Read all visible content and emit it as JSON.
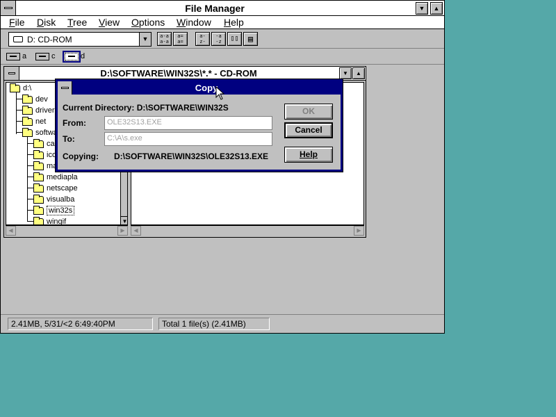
{
  "window": {
    "title": "File Manager"
  },
  "menu": [
    {
      "label": "File",
      "accel": "F"
    },
    {
      "label": "Disk",
      "accel": "D"
    },
    {
      "label": "Tree",
      "accel": "T"
    },
    {
      "label": "View",
      "accel": "V"
    },
    {
      "label": "Options",
      "accel": "O"
    },
    {
      "label": "Window",
      "accel": "W"
    },
    {
      "label": "Help",
      "accel": "H"
    }
  ],
  "toolbar": {
    "drive_selected": "D: CD-ROM",
    "buttons": [
      {
        "name": "view-large-icons-button",
        "glyph": "a-a\na-a"
      },
      {
        "name": "view-details-button",
        "glyph": "a=\na="
      },
      {
        "name": "sort-by-name-button",
        "glyph": "a-\nz-"
      },
      {
        "name": "sort-by-type-button",
        "glyph": "-a\n-z"
      },
      {
        "name": "copy-button",
        "glyph": "▯▯"
      },
      {
        "name": "properties-button",
        "glyph": "▤"
      }
    ]
  },
  "drives": [
    {
      "letter": "a",
      "active": false
    },
    {
      "letter": "c",
      "active": false
    },
    {
      "letter": "d",
      "active": true
    }
  ],
  "dir_window": {
    "title": "D:\\SOFTWARE\\WIN32S\\*.* - CD-ROM",
    "tree": [
      {
        "label": "d:\\",
        "level": 0
      },
      {
        "label": "dev",
        "level": 1
      },
      {
        "label": "drivers",
        "level": 1
      },
      {
        "label": "net",
        "level": 1
      },
      {
        "label": "softwa",
        "level": 1
      },
      {
        "label": "cal",
        "level": 2
      },
      {
        "label": "ico",
        "level": 2
      },
      {
        "label": "ma",
        "level": 2
      },
      {
        "label": "mediapla",
        "level": 2
      },
      {
        "label": "netscape",
        "level": 2
      },
      {
        "label": "visualba",
        "level": 2
      },
      {
        "label": "win32s",
        "level": 2,
        "selected": true
      },
      {
        "label": "wingif",
        "level": 2
      }
    ]
  },
  "copy_dialog": {
    "title": "Copy",
    "current_dir_label": "Current Directory:",
    "current_dir": "D:\\SOFTWARE\\WIN32S",
    "from_label": "From:",
    "from_value": "OLE32S13.EXE",
    "to_label": "To:",
    "to_value": "C:\\A\\s.exe",
    "copying_label": "Copying:",
    "copying_value": "D:\\SOFTWARE\\WIN32S\\OLE32S13.EXE",
    "ok_label": "OK",
    "cancel_label": "Cancel",
    "help_label": "Help"
  },
  "status": {
    "left": "2.41MB, 5/31/<2 6:49:40PM",
    "right": "Total 1 file(s) (2.41MB)"
  },
  "colors": {
    "desktop": "#55A8A8",
    "face": "#C0C0C0",
    "active_title": "#000080",
    "folder": "#FFFF80"
  }
}
